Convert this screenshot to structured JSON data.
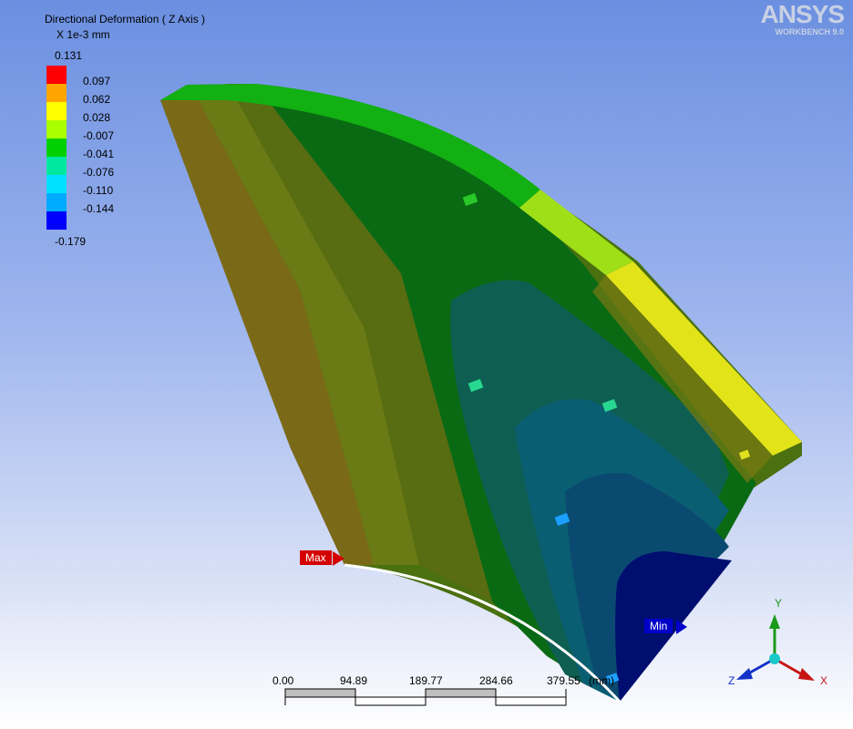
{
  "legend": {
    "title": "Directional Deformation ( Z Axis )",
    "units": "X 1e-3 mm",
    "max": "0.131",
    "min": "-0.179",
    "levels": [
      "0.097",
      "0.062",
      "0.028",
      "-0.007",
      "-0.041",
      "-0.076",
      "-0.110",
      "-0.144"
    ],
    "colors": [
      "#ff0000",
      "#ffa500",
      "#ffff00",
      "#aaff00",
      "#00d000",
      "#00e8a0",
      "#00e0ff",
      "#00aaff",
      "#0000ff"
    ]
  },
  "logo": {
    "brand": "ANSYS",
    "sub": "WORKBENCH 9.0"
  },
  "probes": {
    "max_label": "Max",
    "min_label": "Min"
  },
  "scale": {
    "ticks": [
      "0.00",
      "94.89",
      "189.77",
      "284.66",
      "379.55"
    ],
    "unit": "(mm)"
  },
  "triad": {
    "x": "X",
    "y": "Y",
    "z": "Z"
  }
}
